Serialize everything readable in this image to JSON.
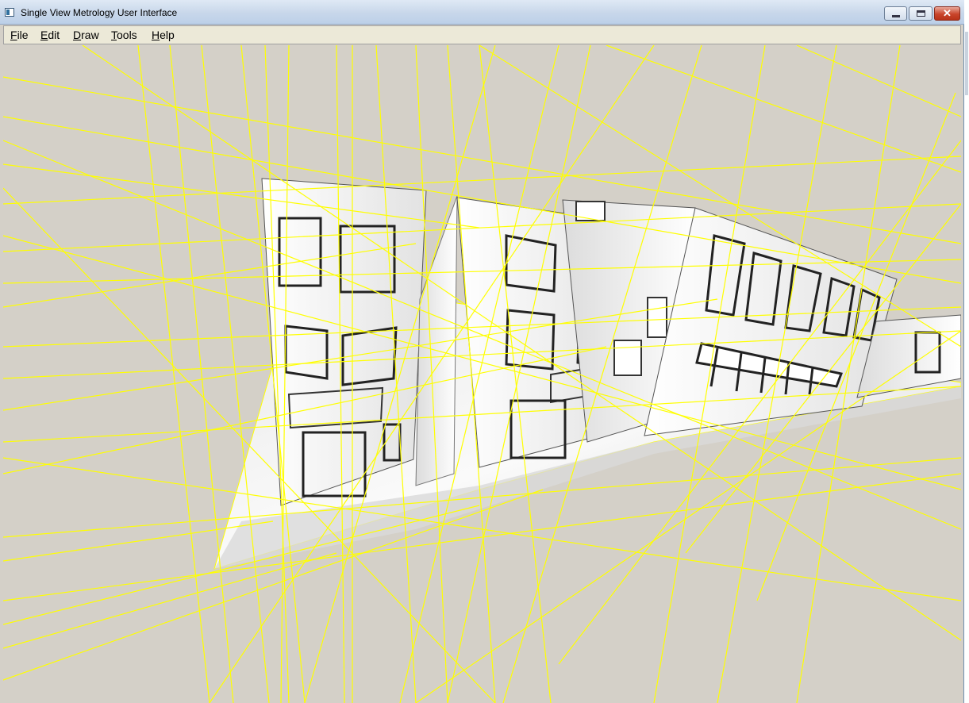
{
  "window": {
    "title": "Single View Metrology User Interface",
    "icon": "app-icon",
    "controls": [
      "minimize-icon",
      "maximize-icon",
      "close-icon"
    ],
    "close_glyph": "✕"
  },
  "menu": {
    "items": [
      {
        "label": "File",
        "mnemonic": "F"
      },
      {
        "label": "Edit",
        "mnemonic": "E"
      },
      {
        "label": "Draw",
        "mnemonic": "D"
      },
      {
        "label": "Tools",
        "mnemonic": "T"
      },
      {
        "label": "Help",
        "mnemonic": "H"
      }
    ]
  },
  "viewport": {
    "background": "#d4d0c8",
    "line_color": "#ffff00",
    "content": "3D reconstruction of a sketched street scene with textured building facades, ground plane and yellow vanishing/guide lines"
  }
}
